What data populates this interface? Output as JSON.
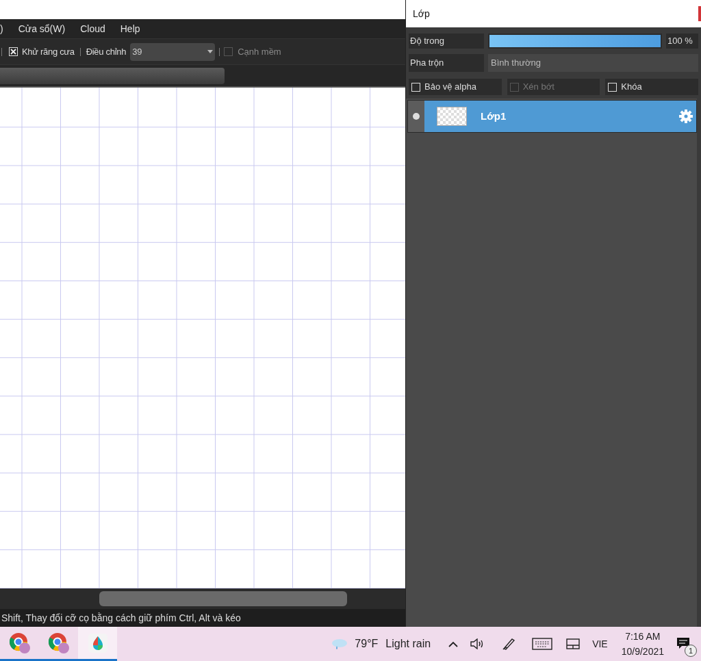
{
  "menu": [
    ")",
    "Cửa sổ(W)",
    "Cloud",
    "Help"
  ],
  "toolbar": {
    "antialias": {
      "label": "Khử răng cưa",
      "checked": true
    },
    "adjust": {
      "label": "Điều chỉnh",
      "value": "39"
    },
    "soft_edge": {
      "label": "Cạnh mềm",
      "checked": false
    }
  },
  "status_bar": "Shift, Thay đổi cỡ cọ bằng cách giữ phím Ctrl, Alt và kéo",
  "layer_panel": {
    "title": "Lớp",
    "opacity": {
      "label": "Độ trong",
      "level": 1.0,
      "reading": "100 %"
    },
    "blend": {
      "label": "Pha trộn",
      "value": "Bình thường"
    },
    "options": [
      {
        "label": "Bảo vệ alpha",
        "checked": false,
        "disabled": false
      },
      {
        "label": "Xén bớt",
        "checked": false,
        "disabled": true
      },
      {
        "label": "Khóa",
        "checked": false,
        "disabled": false
      }
    ],
    "layers": [
      {
        "name": "Lớp1",
        "selected": true,
        "visible": true
      }
    ]
  },
  "taskbar": {
    "apps": [
      {
        "kind": "browser",
        "active": true
      },
      {
        "kind": "browser",
        "active": true
      },
      {
        "kind": "paint",
        "active": true
      }
    ],
    "weather": {
      "temp": "79°F",
      "text": "Light rain"
    },
    "language": "VIE",
    "time": "7:16 AM",
    "date": "10/9/2021",
    "notifications": "1"
  }
}
